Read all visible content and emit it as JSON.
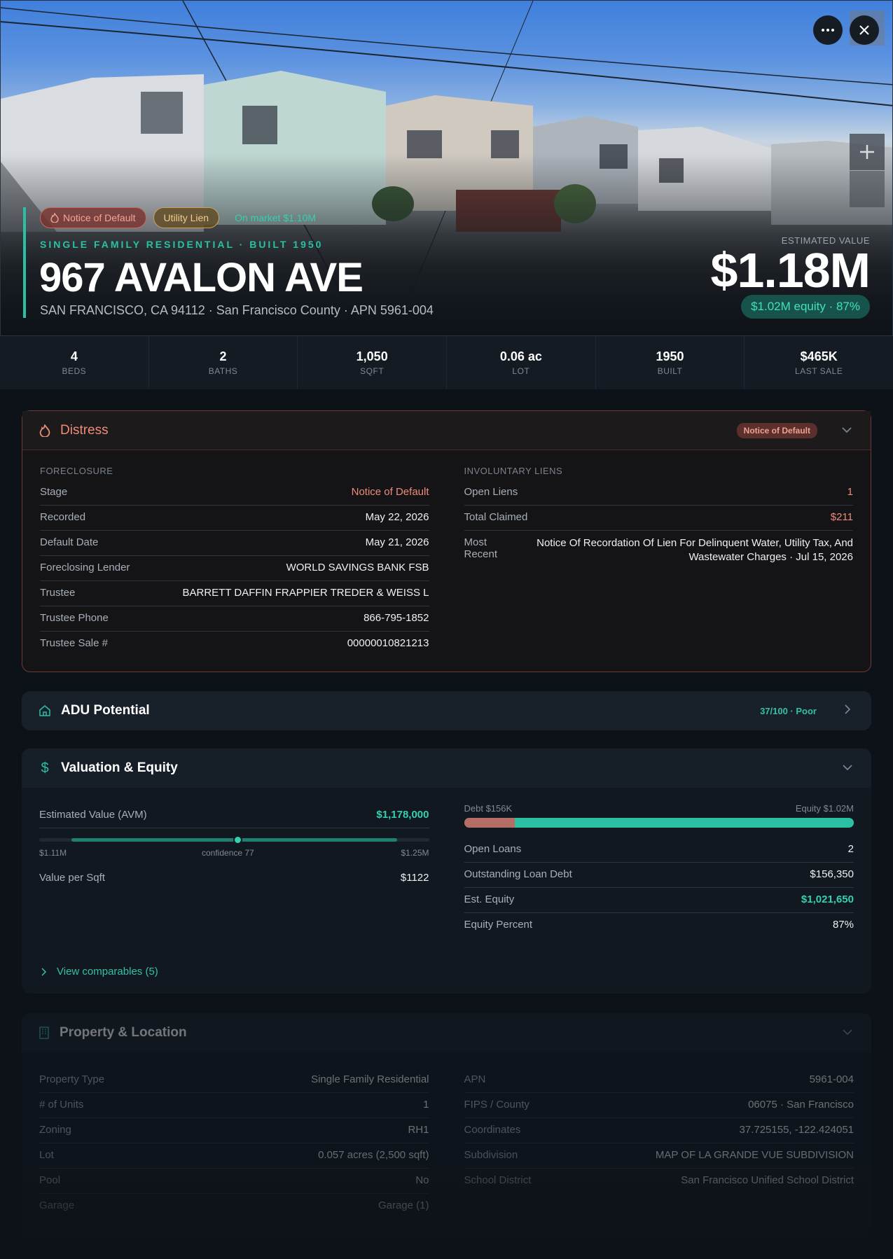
{
  "hero": {
    "chips": {
      "notice": "Notice of Default",
      "lien": "Utility Lien",
      "market": "On market $1.10M"
    },
    "subtitle": "SINGLE FAMILY RESIDENTIAL · BUILT 1950",
    "address": "967 AVALON AVE",
    "location": "SAN FRANCISCO, CA 94112 · San Francisco County · APN 5961-004",
    "est_label": "ESTIMATED VALUE",
    "est_value": "$1.18M",
    "equity": "$1.02M equity · 87%"
  },
  "stats": [
    {
      "value": "4",
      "label": "BEDS"
    },
    {
      "value": "2",
      "label": "BATHS"
    },
    {
      "value": "1,050",
      "label": "SQFT"
    },
    {
      "value": "0.06 ac",
      "label": "LOT"
    },
    {
      "value": "1950",
      "label": "BUILT"
    },
    {
      "value": "$465K",
      "label": "LAST SALE"
    }
  ],
  "distress": {
    "title": "Distress",
    "badge": "Notice of Default",
    "foreclosure_label": "FORECLOSURE",
    "foreclosure": [
      {
        "k": "Stage",
        "v": "Notice of Default"
      },
      {
        "k": "Recorded",
        "v": "May 22, 2026"
      },
      {
        "k": "Default Date",
        "v": "May 21, 2026"
      },
      {
        "k": "Foreclosing Lender",
        "v": "WORLD SAVINGS BANK FSB"
      },
      {
        "k": "Trustee",
        "v": "BARRETT DAFFIN FRAPPIER TREDER & WEISS L"
      },
      {
        "k": "Trustee Phone",
        "v": "866-795-1852"
      },
      {
        "k": "Trustee Sale #",
        "v": "00000010821213"
      }
    ],
    "liens_label": "INVOLUNTARY LIENS",
    "liens": [
      {
        "k": "Open Liens",
        "v": "1"
      },
      {
        "k": "Total Claimed",
        "v": "$211"
      },
      {
        "k": "Most Recent",
        "v": "Notice Of Recordation Of Lien For Delinquent Water, Utility Tax, And Wastewater Charges · Jul 15, 2026"
      }
    ]
  },
  "adu": {
    "title": "ADU Potential",
    "score": "37/100 · Poor"
  },
  "valuation": {
    "title": "Valuation & Equity",
    "avm_label": "Estimated Value (AVM)",
    "avm_value": "$1,178,000",
    "range_low": "$1.11M",
    "range_mid": "confidence 77",
    "range_high": "$1.25M",
    "psf_label": "Value per Sqft",
    "psf_value": "$1122",
    "debt_label": "Debt $156K",
    "equity_label": "Equity $1.02M",
    "debt_fraction": 0.13,
    "loans": [
      {
        "k": "Open Loans",
        "v": "2"
      },
      {
        "k": "Outstanding Loan Debt",
        "v": "$156,350"
      },
      {
        "k": "Est. Equity",
        "v": "$1,021,650"
      },
      {
        "k": "Equity Percent",
        "v": "87%"
      }
    ],
    "comps": "View comparables (5)"
  },
  "property": {
    "title": "Property & Location",
    "left": [
      {
        "k": "Property Type",
        "v": "Single Family Residential"
      },
      {
        "k": "# of Units",
        "v": "1"
      },
      {
        "k": "Zoning",
        "v": "RH1"
      },
      {
        "k": "Lot",
        "v": "0.057 acres (2,500 sqft)"
      },
      {
        "k": "Pool",
        "v": "No"
      },
      {
        "k": "Garage",
        "v": "Garage (1)"
      }
    ],
    "right": [
      {
        "k": "APN",
        "v": "5961-004"
      },
      {
        "k": "FIPS / County",
        "v": "06075 · San Francisco"
      },
      {
        "k": "Coordinates",
        "v": "37.725155, -122.424051"
      },
      {
        "k": "Subdivision",
        "v": "MAP OF LA GRANDE VUE SUBDIVISION"
      },
      {
        "k": "School District",
        "v": "San Francisco Unified School District"
      }
    ]
  },
  "colors": {
    "accent": "#2bc0a4",
    "danger": "#ef8b78",
    "debt": "#b46e66"
  }
}
